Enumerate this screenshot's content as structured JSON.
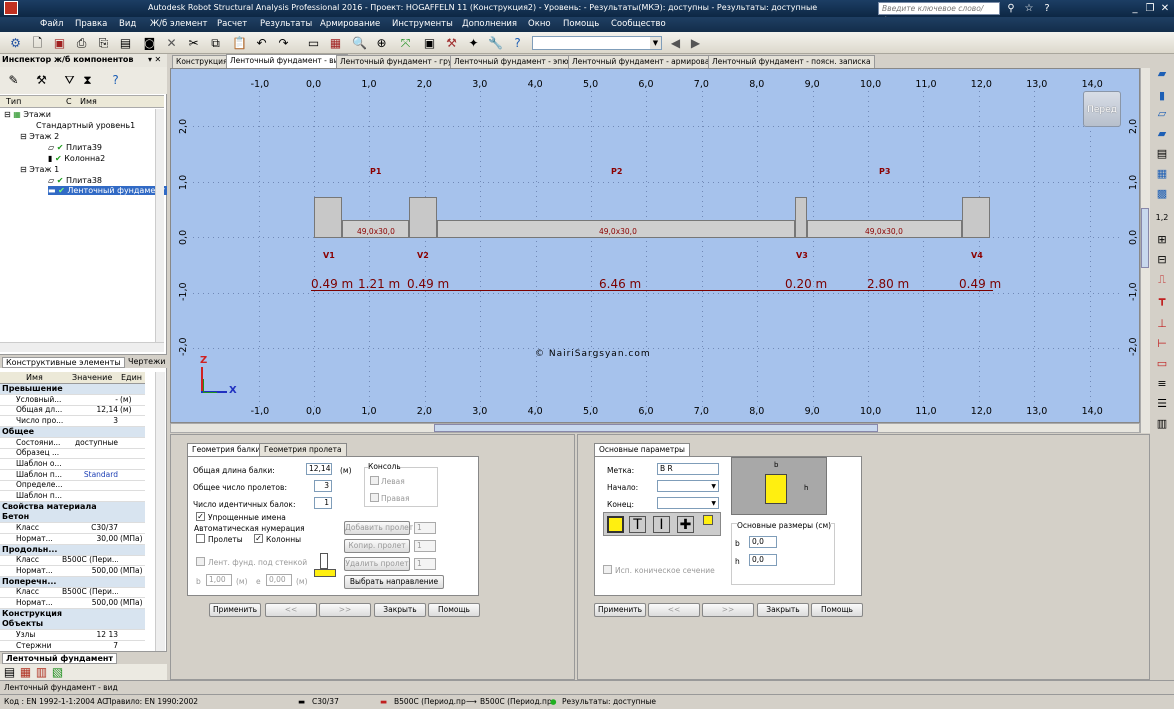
{
  "window": {
    "title": "Autodesk Robot Structural Analysis Professional 2016 - Проект: HOGAFFELN 11 (Конструкция2) - Уровень:  - Результаты(МКЭ): доступны - Результаты: доступные",
    "search_placeholder": "Введите ключевое слово/фразу"
  },
  "menu": [
    "Файл",
    "Правка",
    "Вид",
    "Ж/б элемент",
    "Расчет",
    "Результаты",
    "Армирование",
    "Инструменты",
    "Дополнения",
    "Окно",
    "Помощь",
    "Сообщество"
  ],
  "left_panel": {
    "title": "Инспектор ж/б компонентов",
    "columns": [
      "Тип",
      "С",
      "Имя"
    ],
    "tree": {
      "floors": "Этажи",
      "standard_level": "Стандартный уровень1",
      "floor2": "Этаж 2",
      "slab39": "Плита39",
      "column2": "Колонна2",
      "floor1": "Этаж 1",
      "slab38": "Плита38",
      "strip": "Ленточный фундамент"
    },
    "tabs": [
      "Конструктивные элементы",
      "Чертежи"
    ],
    "prop_headers": [
      "Имя",
      "Значение",
      "Един"
    ],
    "props": [
      {
        "cat": true,
        "name": "Превышение"
      },
      {
        "name": "Условный...",
        "value": "-",
        "unit": "(м)"
      },
      {
        "name": "Общая дл...",
        "value": "12,14",
        "unit": "(м)"
      },
      {
        "name": "Число про...",
        "value": "3",
        "unit": ""
      },
      {
        "cat": true,
        "name": "Общее"
      },
      {
        "name": "Состояни...",
        "value": "доступные",
        "unit": ""
      },
      {
        "name": "Образец ...",
        "value": "",
        "unit": ""
      },
      {
        "name": "Шаблон о...",
        "value": "",
        "unit": ""
      },
      {
        "name": "Шаблон п...",
        "value": "Standard",
        "unit": ""
      },
      {
        "name": "Определе...",
        "value": "",
        "unit": ""
      },
      {
        "name": "Шаблон п...",
        "value": "",
        "unit": ""
      },
      {
        "cat": true,
        "name": "Свойства материала"
      },
      {
        "cat": true,
        "name": "Бетон"
      },
      {
        "name": "Класс",
        "value": "C30/37",
        "unit": ""
      },
      {
        "name": "Нормат...",
        "value": "30,00",
        "unit": "(МПа)"
      },
      {
        "cat": true,
        "name": "Продольн..."
      },
      {
        "name": "Класс",
        "value": "B500C (Пери...",
        "unit": ""
      },
      {
        "name": "Нормат...",
        "value": "500,00",
        "unit": "(МПа)"
      },
      {
        "cat": true,
        "name": "Поперечн..."
      },
      {
        "name": "Класс",
        "value": "B500C (Пери...",
        "unit": ""
      },
      {
        "name": "Нормат...",
        "value": "500,00",
        "unit": "(МПа)"
      },
      {
        "cat": true,
        "name": "Конструкция"
      },
      {
        "cat": true,
        "name": "Объекты"
      },
      {
        "name": "Узлы",
        "value": "12 13",
        "unit": ""
      },
      {
        "name": "Стержни",
        "value": "7",
        "unit": ""
      }
    ],
    "bottom_tab": "Ленточный фундамент"
  },
  "view_tabs": [
    "Конструкция",
    "Ленточный фундамент - вид",
    "Ленточный фундамент - грунт",
    "Ленточный фундамент - эпюры",
    "Ленточный фундамент - армирование",
    "Ленточный фундамент - поясн. записка"
  ],
  "canvas": {
    "x_ticks": [
      "-1,0",
      "0,0",
      "1,0",
      "2,0",
      "3,0",
      "4,0",
      "5,0",
      "6,0",
      "7,0",
      "8,0",
      "9,0",
      "10,0",
      "11,0",
      "12,0",
      "13,0",
      "14,0"
    ],
    "y_ticks": [
      "2,0",
      "1,0",
      "0,0",
      "-1,0",
      "-2,0"
    ],
    "spans": [
      "P1",
      "P2",
      "P3"
    ],
    "supports": [
      "V1",
      "V2",
      "V3",
      "V4"
    ],
    "beam_labels": [
      "49,0x30,0",
      "49,0x30,0",
      "49,0x30,0"
    ],
    "dims": [
      "0.49 m",
      "1.21 m",
      "0.49 m",
      "6.46 m",
      "0.20 m",
      "2.80 m",
      "0.49 m"
    ],
    "watermark": "©  NairiSargsyan.com",
    "front_label": "Перед",
    "axis_x": "X",
    "axis_z": "Z"
  },
  "beam_dialog": {
    "tabs": [
      "Геометрия балки",
      "Геометрия пролета"
    ],
    "total_length_label": "Общая длина балки:",
    "total_length": "12,14",
    "total_length_unit": "(м)",
    "spans_count_label": "Общее число пролетов:",
    "spans_count": "3",
    "identical_label": "Число идентичных балок:",
    "identical": "1",
    "simplified_names": "Упрощенные имена",
    "auto_numbering": "Автоматическая нумерация",
    "spans_cb": "Пролеты",
    "columns_cb": "Колонны",
    "console_label": "Консоль",
    "left": "Левая",
    "right": "Правая",
    "add_span": "Добавить пролет",
    "copy_span": "Копир. пролет",
    "delete_span": "Удалить пролет",
    "spin_value": "1",
    "strip_under_wall": "Лент. фунд. под стенкой",
    "b_label": "b",
    "b_value": "1,00",
    "e_label": "e",
    "e_value": "0,00",
    "unit_m": "(м)",
    "choose_direction": "Выбрать направление",
    "apply": "Применить",
    "prev": "<<",
    "next": ">>",
    "close": "Закрыть",
    "help": "Помощь"
  },
  "params_dialog": {
    "tab": "Основные параметры",
    "mark_label": "Метка:",
    "mark_value": "B R",
    "start_label": "Начало:",
    "end_label": "Конец:",
    "conical": "Исп. коническое сечение",
    "main_dims": "Основные размеры (см)",
    "b_label": "b",
    "b_value": "0,0",
    "h_label": "h",
    "h_value": "0,0",
    "apply": "Применить",
    "prev": "<<",
    "next": ">>",
    "close": "Закрыть",
    "help": "Помощь"
  },
  "status": {
    "view_name": "Ленточный фундамент - вид",
    "code": "Код : EN 1992-1-1:2004 AC",
    "rule": "Правило: EN 1990:2002",
    "concrete": "C30/37",
    "long_rebar": "B500C (Период.пр",
    "trans_rebar": "B500C (Период.пр",
    "results": "Результаты: доступные"
  }
}
